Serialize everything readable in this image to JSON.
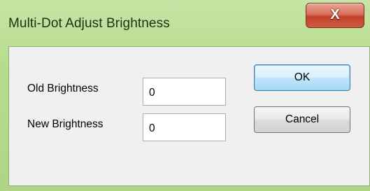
{
  "window": {
    "title": "Multi-Dot Adjust Brightness",
    "close_glyph": "X",
    "close_icon": "close-icon"
  },
  "form": {
    "old_brightness_label": "Old Brightness",
    "old_brightness_value": "0",
    "new_brightness_label": "New Brightness",
    "new_brightness_value": "0"
  },
  "buttons": {
    "ok_label": "OK",
    "cancel_label": "Cancel"
  },
  "colors": {
    "title_bar": "#b7dc8e",
    "close_button": "#c2432c",
    "default_button_border": "#3c7fb1",
    "client_background": "#f0f0f0"
  }
}
